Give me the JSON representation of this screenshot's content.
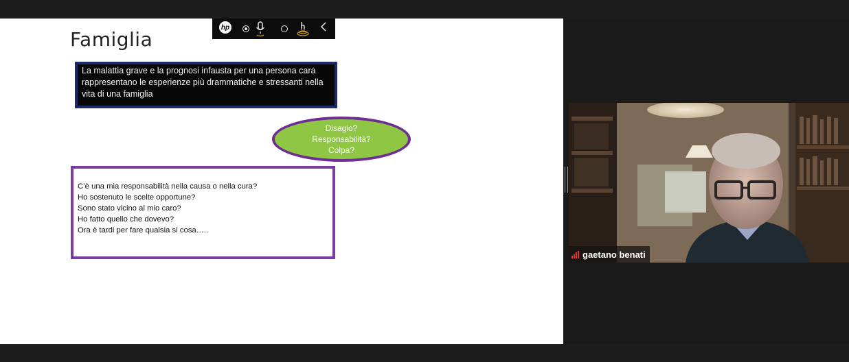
{
  "slide": {
    "title": "Famiglia",
    "black_box_text": "La malattia grave e la prognosi infausta per una persona cara rappresentano le esperienze più drammatiche  e stressanti nella vita di una famiglia",
    "ellipse_lines": [
      "Disagio?",
      "Responsabilità?",
      "Colpa?"
    ],
    "question_lines": [
      "C’è una mia responsabilità nella causa o nella cura?",
      "Ho sostenuto le scelte opportune?",
      "Sono stato vicino al mio caro?",
      "Ho fatto quello che dovevo?",
      "Ora è tardi per fare qualsia si cosa….."
    ]
  },
  "toolbar": {
    "icons": [
      "hp-logo-icon",
      "radio-selected-icon",
      "microphone-icon",
      "radio-icon",
      "touch-gesture-icon",
      "chevron-left-icon"
    ]
  },
  "participant": {
    "name": "gaetano benati"
  },
  "colors": {
    "black_box_border": "#1d2a6b",
    "ellipse_fill": "#8fc744",
    "ellipse_border": "#6e2d93",
    "question_box_border": "#7c3b9f",
    "signal": "#e03a2e"
  }
}
